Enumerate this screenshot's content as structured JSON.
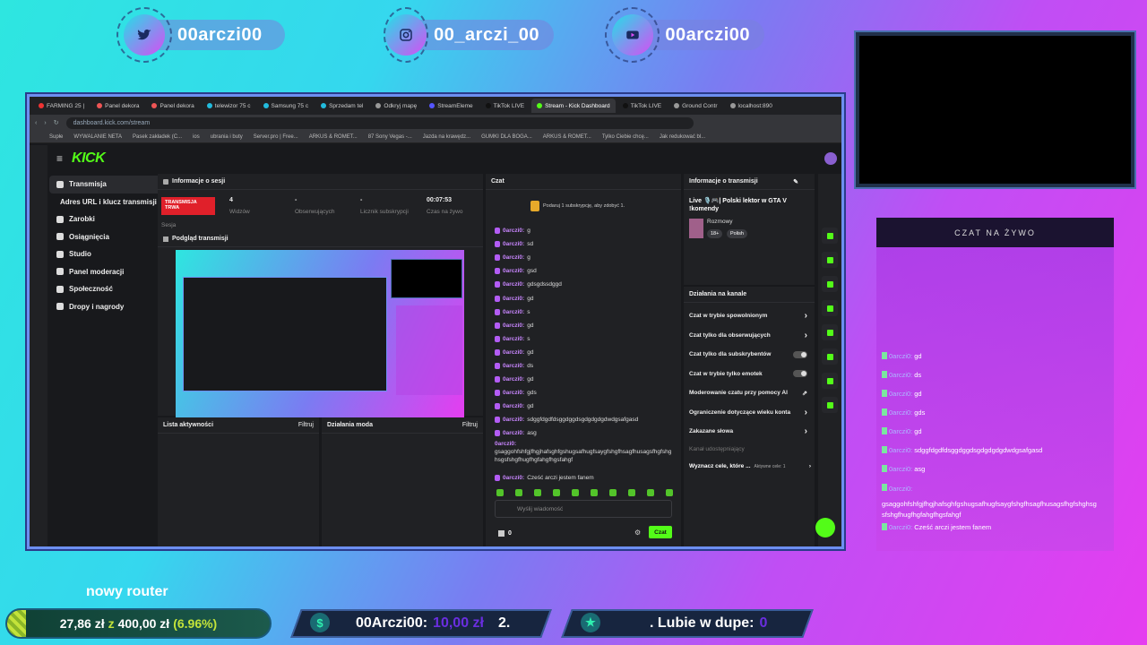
{
  "socials": [
    {
      "platform": "twitter",
      "icon": "twitter-icon",
      "handle": "00arczi00"
    },
    {
      "platform": "instagram",
      "icon": "instagram-icon",
      "handle": "00_arczi_00"
    },
    {
      "platform": "youtube",
      "icon": "youtube-icon",
      "handle": "00arczi00"
    }
  ],
  "browser": {
    "tabs": [
      "FARMING 25 |",
      "Panel dekora",
      "Panel dekora",
      "telewizor 75 c",
      "Samsung 75 c",
      "Sprzedam tel",
      "Odkryj mapę",
      "StreamEleme",
      "TikTok LIVE",
      "Stream - Kick Dashboard",
      "TikTok LIVE",
      "Ground Contr",
      "localhost:890"
    ],
    "url": "dashboard.kick.com/stream",
    "bookmarks": [
      "Supłe",
      "WYWALANIE NETA",
      "Pasek zakładek (C...",
      "ios",
      "ubrania i buty",
      "Server.pro | Free...",
      "ARKUS & ROMET...",
      "87 Sony Vegas -...",
      "Jazda na krawędz...",
      "GUMKI DLA BOGA...",
      "ARKUS & ROMET...",
      "Tylko Ciebie chcę...",
      "Jak redukować bl..."
    ]
  },
  "kick": {
    "logo": "KICK",
    "nav": [
      {
        "label": "Transmisja",
        "active": true
      },
      {
        "label": "Adres URL i klucz transmisji",
        "active": false
      },
      {
        "label": "Zarobki",
        "active": false
      },
      {
        "label": "Osiągnięcia",
        "active": false
      },
      {
        "label": "Studio",
        "active": false
      },
      {
        "label": "Panel moderacji",
        "active": false
      },
      {
        "label": "Społeczność",
        "active": false
      },
      {
        "label": "Dropy i nagrody",
        "active": false
      }
    ],
    "session": {
      "title": "Informacje o sesji",
      "live_badge": "TRANSMISJA TRWA",
      "live_sub": "Sesja",
      "stats": [
        {
          "value": "4",
          "label": "Widzów"
        },
        {
          "value": "-",
          "label": "Obserwujących"
        },
        {
          "value": "-",
          "label": "Licznik subskrypcji"
        },
        {
          "value": "00:07:53",
          "label": "Czas na żywo"
        }
      ]
    },
    "preview_title": "Podgląd transmisji",
    "activity": {
      "title": "Lista aktywności",
      "filter": "Filtruj"
    },
    "modactions": {
      "title": "Działania moda",
      "filter": "Filtruj"
    },
    "chat": {
      "title": "Czat",
      "pinned": "Podaruj 1 subskrypcję, aby zdobyć 1.",
      "messages": [
        {
          "user": "0arczi0:",
          "text": "g"
        },
        {
          "user": "0arczi0:",
          "text": "sd"
        },
        {
          "user": "0arczi0:",
          "text": "g"
        },
        {
          "user": "0arczi0:",
          "text": "gsd"
        },
        {
          "user": "0arczi0:",
          "text": "gdsgdssdggd"
        },
        {
          "user": "0arczi0:",
          "text": "gd"
        },
        {
          "user": "0arczi0:",
          "text": "s"
        },
        {
          "user": "0arczi0:",
          "text": "gd"
        },
        {
          "user": "0arczi0:",
          "text": "s"
        },
        {
          "user": "0arczi0:",
          "text": "gd"
        },
        {
          "user": "0arczi0:",
          "text": "ds"
        },
        {
          "user": "0arczi0:",
          "text": "gd"
        },
        {
          "user": "0arczi0:",
          "text": "gds"
        },
        {
          "user": "0arczi0:",
          "text": "gd"
        },
        {
          "user": "0arczi0:",
          "text": "sdggfdgdfdsggdggdsgdgdgdgdwdgsafgasd"
        },
        {
          "user": "0arczi0:",
          "text": "asg"
        }
      ],
      "long_message": {
        "user": "0arczi0:",
        "text": "gsaggohfshfgjfhgjhafsghfgshugsafhugfsaygfshgfhsagfhusagsfhgfshghsgsfshgfhugfhgfahgfhgsfahgf"
      },
      "last_message": {
        "user": "0arczi0:",
        "text": "Cześć arczi jestem fanem"
      },
      "input_placeholder": "Wyślij wiadomość",
      "points": "0",
      "send_label": "Czat"
    },
    "stream_info": {
      "title": "Informacje o transmisji",
      "stream_title": "Live 🎙️🎮| Polski lektor w GTA V !komendy",
      "category": "Rozmowy",
      "tags": [
        "18+",
        "Polish"
      ]
    },
    "channel_actions": {
      "title": "Działania na kanale",
      "items": [
        {
          "label": "Czat w trybie spowolnionym",
          "control": "chevron"
        },
        {
          "label": "Czat tylko dla obserwujących",
          "control": "chevron"
        },
        {
          "label": "Czat tylko dla subskrybentów",
          "control": "toggle"
        },
        {
          "label": "Czat w trybie tylko emotek",
          "control": "toggle"
        },
        {
          "label": "Moderowanie czatu przy pomocy AI",
          "control": "chart"
        },
        {
          "label": "Ograniczenie dotyczące wieku konta",
          "control": "chevron"
        },
        {
          "label": "Zakazane słowa",
          "control": "chevron"
        }
      ],
      "shared_label": "Kanał udostępniający",
      "goal_label": "Wyznacz cele, które ...",
      "goal_status": "Aktywne cele: 1"
    }
  },
  "livechat": {
    "header": "CZAT NA ŻYWO",
    "messages": [
      {
        "user": "0arczi0:",
        "text": "gd"
      },
      {
        "user": "0arczi0:",
        "text": "ds"
      },
      {
        "user": "0arczi0:",
        "text": "gd"
      },
      {
        "user": "0arczi0:",
        "text": "gds"
      },
      {
        "user": "0arczi0:",
        "text": "gd"
      },
      {
        "user": "0arczi0:",
        "text": "sdggfdgdfdsggdggdsgdgdgdgdwdgsafgasd"
      },
      {
        "user": "0arczi0:",
        "text": "asg"
      },
      {
        "user": "0arczi0:",
        "text": "gsaggohfshfgjfhgjhafsghfgshugsafhugfsaygfshgfhsagfhusagsfhgfshghsgsfshgfhugfhgfahgfhgsfahgf"
      },
      {
        "user": "0arczi0:",
        "text": "Cześć arczi jestem fanem"
      }
    ]
  },
  "goal": {
    "title": "nowy router",
    "current": "27,86 zł",
    "sep": "z",
    "target": "400,00 zł",
    "percent": "(6.96%)",
    "progress": 0.0696
  },
  "donation_ticker": {
    "name": "00Arczi00:",
    "amount": "10,00 zł",
    "rank": "2.",
    "icon": "dollar-icon"
  },
  "follow_ticker": {
    "text": ". Lubie w dupe:",
    "count": "0",
    "icon": "star-icon"
  },
  "colors": {
    "kick_green": "#53fc18",
    "chat_user": "#c986ff",
    "overlay_cyan": "#2ee6e0",
    "overlay_magenta": "#e53df0"
  }
}
